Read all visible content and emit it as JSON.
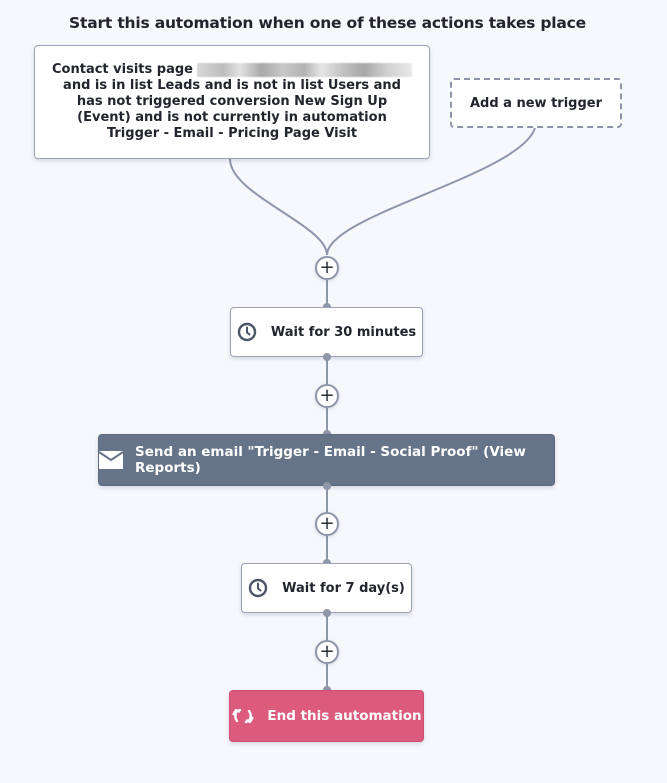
{
  "header": {
    "title": "Start this automation when one of these actions takes place"
  },
  "triggers": [
    {
      "line1_prefix": "Contact visits page",
      "redacted_url": true,
      "rest": "and is in list Leads and is not in list Users and has not triggered conversion New Sign Up (Event) and is not currently in automation Trigger - Email - Pricing Page Visit"
    }
  ],
  "add_trigger": {
    "label": "Add a new trigger"
  },
  "steps": [
    {
      "type": "wait",
      "icon": "clock-icon",
      "label": "Wait for 30 minutes"
    },
    {
      "type": "email",
      "icon": "envelope-icon",
      "label": "Send an email \"Trigger - Email - Social Proof\" (View Reports)"
    },
    {
      "type": "wait",
      "icon": "clock-icon",
      "label": "Wait for 7 day(s)"
    },
    {
      "type": "end",
      "icon": "loop-arrows-icon",
      "label": "End this automation"
    }
  ],
  "add_step_symbol": "+",
  "colors": {
    "background": "#f7f8fc",
    "connector": "#8f96aa",
    "email_node": "#667489",
    "end_node": "#dc5b7d"
  }
}
